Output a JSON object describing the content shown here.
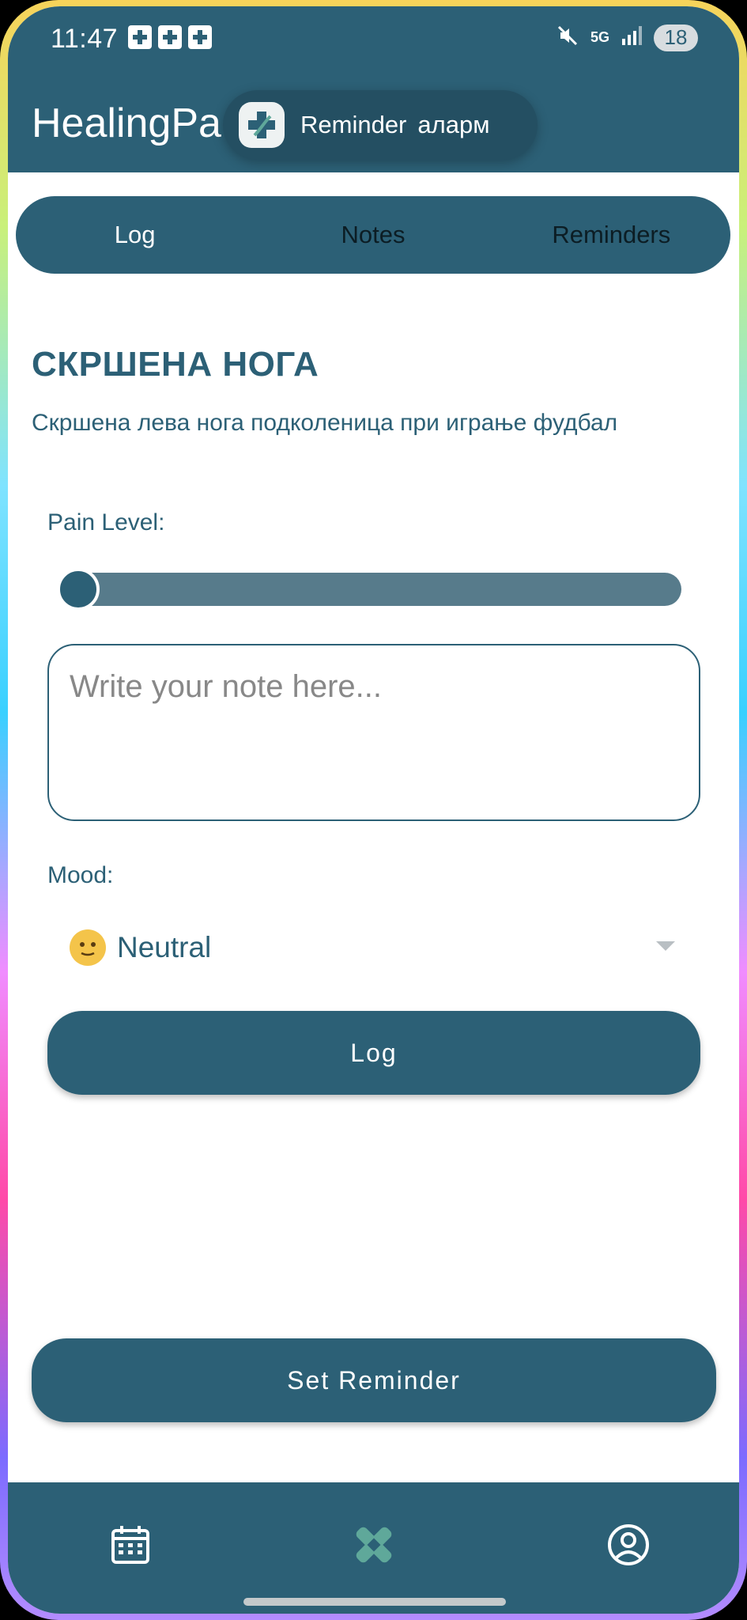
{
  "status_bar": {
    "time": "11:47",
    "network": "5G",
    "battery": "18"
  },
  "app": {
    "title": "HealingPa"
  },
  "toast": {
    "title": "Reminder",
    "subtitle": "аларм"
  },
  "tabs": [
    {
      "label": "Log",
      "active": true
    },
    {
      "label": "Notes",
      "active": false
    },
    {
      "label": "Reminders",
      "active": false
    }
  ],
  "injury": {
    "title": "СКРШЕНА НОГА",
    "description": "Скршена лева нога подколеница при играње фудбал"
  },
  "pain": {
    "label": "Pain Level:",
    "value_fraction": 0
  },
  "note": {
    "placeholder": "Write your note here..."
  },
  "mood": {
    "label": "Mood:",
    "selected": "Neutral",
    "icon": "neutral-face-icon"
  },
  "buttons": {
    "log": "Log",
    "set_reminder": "Set Reminder"
  },
  "nav": {
    "items": [
      "calendar-icon",
      "bandage-icon",
      "profile-icon"
    ]
  },
  "colors": {
    "primary": "#2c6076",
    "slider_track": "#577b8b",
    "active_nav": "#5fa89a"
  }
}
